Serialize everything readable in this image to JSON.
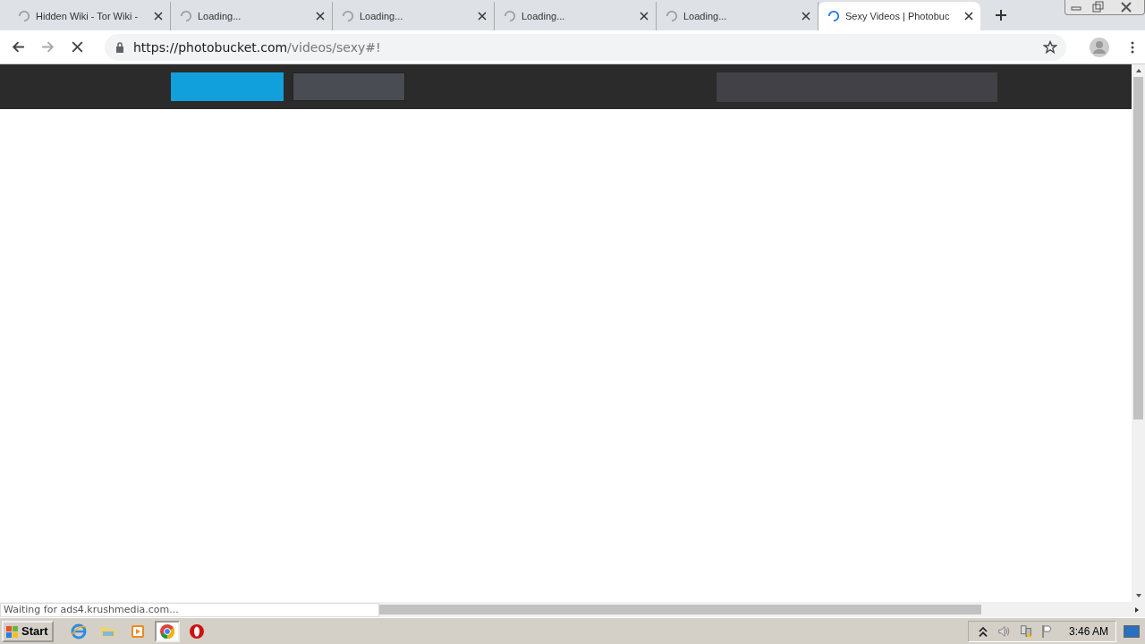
{
  "tabs": [
    {
      "title": "Hidden Wiki - Tor Wiki -",
      "loading": true,
      "selected": false
    },
    {
      "title": "Loading...",
      "loading": true,
      "selected": false
    },
    {
      "title": "Loading...",
      "loading": true,
      "selected": false
    },
    {
      "title": "Loading...",
      "loading": true,
      "selected": false
    },
    {
      "title": "Loading...",
      "loading": true,
      "selected": false
    },
    {
      "title": "Sexy Videos | Photobuc",
      "loading": true,
      "selected": true
    }
  ],
  "address_bar": {
    "host": "https://photobucket.com",
    "path": "/videos/sexy#!",
    "loading": true
  },
  "status_bubble": "Waiting for ads4.krushmedia.com...",
  "taskbar": {
    "start": "Start",
    "apps": [
      {
        "kind": "ie",
        "selected": false
      },
      {
        "kind": "folder",
        "selected": false
      },
      {
        "kind": "media",
        "selected": false
      },
      {
        "kind": "chrome",
        "selected": true
      },
      {
        "kind": "opera",
        "selected": false
      }
    ],
    "clock": "3:46 AM"
  }
}
